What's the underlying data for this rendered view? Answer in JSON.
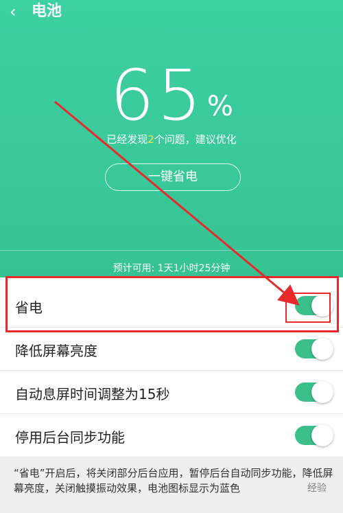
{
  "header": {
    "back_icon": "chevron-left-icon",
    "title": "电池",
    "percent": "65",
    "percent_sign": "%",
    "issues_prefix": "已经发现",
    "issues_count": "2",
    "issues_suffix": "个问题，建议优化",
    "one_click_label": "一键省电",
    "estimate": "预计可用: 1天1小时25分钟",
    "bg_color": "#3dd0a3"
  },
  "settings": [
    {
      "label": "省电",
      "on": true
    },
    {
      "label": "降低屏幕亮度",
      "on": true
    },
    {
      "label": "自动息屏时间调整为15秒",
      "on": true
    },
    {
      "label": "停用后台同步功能",
      "on": true
    }
  ],
  "note": "“省电”开启后，将关闭部分后台应用，暂停后台自动同步功能，降低屏幕亮度，关闭触摸振动效果，电池图标显示为蓝色",
  "watermark": "经验",
  "colors": {
    "toggle_on": "#3bbf8b",
    "annotation": "#e8282a"
  }
}
